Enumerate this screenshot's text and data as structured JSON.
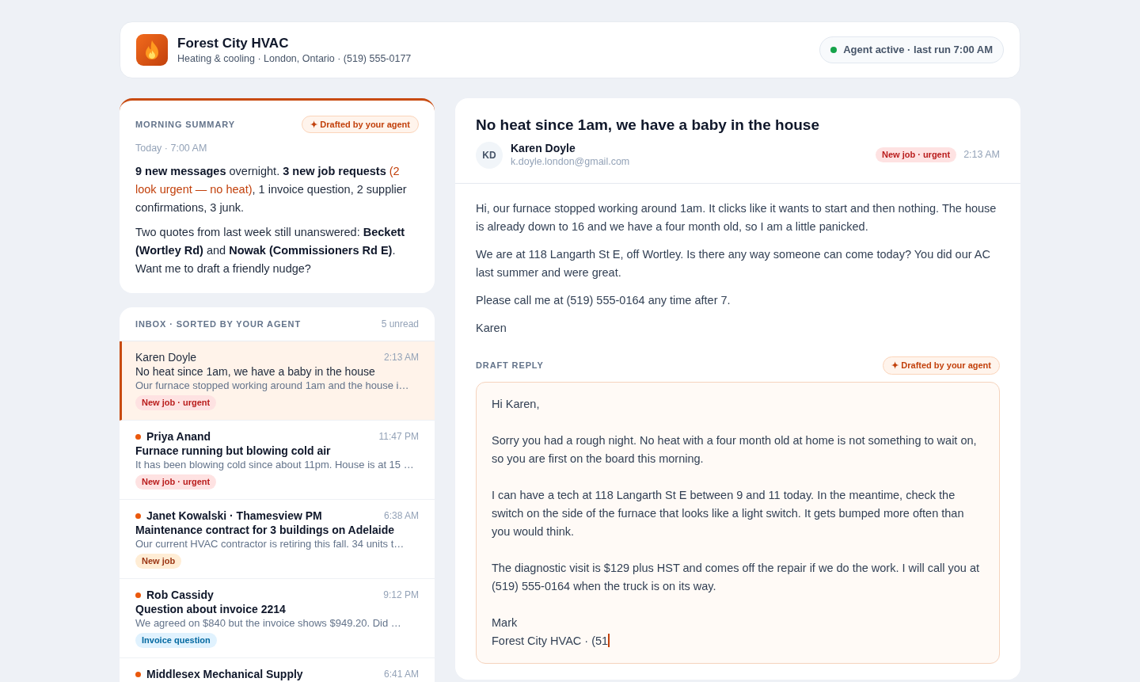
{
  "header": {
    "business_name": "Forest City HVAC",
    "details": "Heating & cooling · London, Ontario · (519) 555-0177",
    "agent": {
      "active": true,
      "text": "Agent active · last run 7:00 AM"
    }
  },
  "summary": {
    "title": "MORNING SUMMARY",
    "badge": "✦ Drafted by your agent",
    "time": "Today · 7:00 AM",
    "paragraphs": [
      [
        {
          "kind": "strong",
          "text": "9 new messages"
        },
        {
          "kind": "plain",
          "text": " overnight. "
        },
        {
          "kind": "strong",
          "text": "3 new job requests"
        },
        {
          "kind": "alert",
          "text": " (2 look urgent — no heat)"
        },
        {
          "kind": "plain",
          "text": ", 1 invoice question, 2 supplier confirmations, 3 junk."
        }
      ],
      [
        {
          "kind": "plain",
          "text": "Two quotes from last week still unanswered: "
        },
        {
          "kind": "strong",
          "text": "Beckett (Wortley Rd)"
        },
        {
          "kind": "plain",
          "text": " and "
        },
        {
          "kind": "strong",
          "text": "Nowak (Commissioners Rd E)"
        },
        {
          "kind": "plain",
          "text": ". Want me to draft a friendly nudge?"
        }
      ]
    ]
  },
  "inbox": {
    "title": "INBOX · SORTED BY YOUR AGENT",
    "count": "5 unread",
    "messages": [
      {
        "sender": "Karen Doyle",
        "time": "2:13 AM",
        "subject": "No heat since 1am, we have a baby in the house",
        "preview": "Our furnace stopped working around 1am and the house i…",
        "tag": {
          "kind": "urgent",
          "text": "New job · urgent"
        },
        "unread": false,
        "selected": true
      },
      {
        "sender": "Priya Anand",
        "time": "11:47 PM",
        "subject": "Furnace running but blowing cold air",
        "preview": "It has been blowing cold since about 11pm. House is at 15 …",
        "tag": {
          "kind": "urgent",
          "text": "New job · urgent"
        },
        "unread": true,
        "selected": false
      },
      {
        "sender": "Janet Kowalski · Thamesview PM",
        "time": "6:38 AM",
        "subject": "Maintenance contract for 3 buildings on Adelaide",
        "preview": "Our current HVAC contractor is retiring this fall. 34 units t…",
        "tag": {
          "kind": "job",
          "text": "New job"
        },
        "unread": true,
        "selected": false
      },
      {
        "sender": "Rob Cassidy",
        "time": "9:12 PM",
        "subject": "Question about invoice 2214",
        "preview": "We agreed on $840 but the invoice shows $949.20. Did …",
        "tag": {
          "kind": "invoice",
          "text": "Invoice question"
        },
        "unread": true,
        "selected": false
      },
      {
        "sender": "Middlesex Mechanical Supply",
        "time": "6:41 AM",
        "unread": true,
        "selected": false
      }
    ]
  },
  "message": {
    "subject": "No heat since 1am, we have a baby in the house",
    "sender": {
      "initials": "KD",
      "name": "Karen Doyle",
      "email": "k.doyle.london@gmail.com"
    },
    "tag": {
      "kind": "urgent",
      "text": "New job · urgent"
    },
    "time": "2:13 AM",
    "body": [
      "Hi, our furnace stopped working around 1am. It clicks like it wants to start and then nothing. The house is already down to 16 and we have a four month old, so I am a little panicked.",
      "We are at 118 Langarth St E, off Wortley. Is there any way someone can come today? You did our AC last summer and were great.",
      "Please call me at (519) 555-0164 any time after 7.",
      "Karen"
    ]
  },
  "draft": {
    "label": "DRAFT REPLY",
    "badge": "✦ Drafted by your agent",
    "value": "Hi Karen,\n\nSorry you had a rough night. No heat with a four month old at home is not something to wait on, so you are first on the board this morning.\n\nI can have a tech at 118 Langarth St E between 9 and 11 today. In the meantime, check the switch on the side of the furnace that looks like a light switch. It gets bumped more often than you would think.\n\nThe diagnostic visit is $129 plus HST and comes off the repair if we do the work. I will call you at (519) 555-0164 when the truck is on its way.\n\nMark\nForest City HVAC · (51",
    "focused": true
  }
}
